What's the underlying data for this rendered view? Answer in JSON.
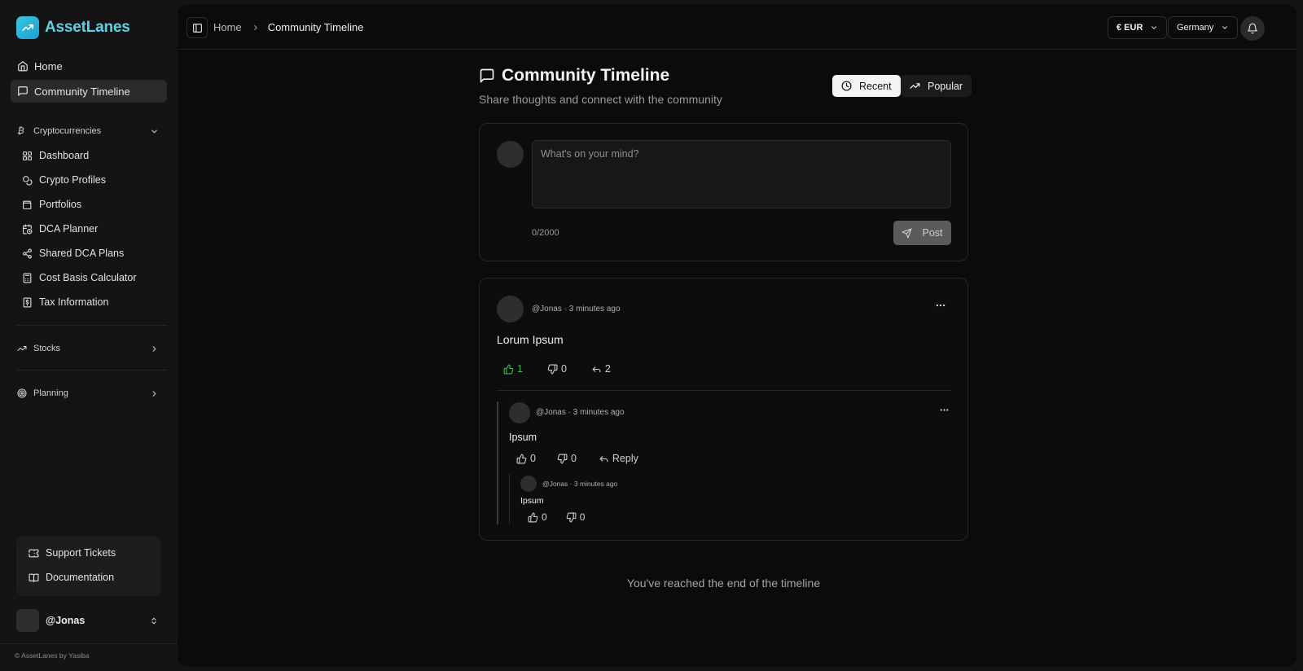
{
  "app": {
    "name": "AssetLanes",
    "copyright": "© AssetLanes by Yasiba"
  },
  "sidebar": {
    "top_items": [
      {
        "label": "Home",
        "icon": "home-icon"
      },
      {
        "label": "Community Timeline",
        "icon": "message-square-icon",
        "active": true
      }
    ],
    "groups": {
      "crypto": {
        "label": "Cryptocurrencies",
        "icon": "bitcoin-icon",
        "expanded": true,
        "items": [
          {
            "label": "Dashboard",
            "icon": "grid-icon"
          },
          {
            "label": "Crypto Profiles",
            "icon": "coins-icon"
          },
          {
            "label": "Portfolios",
            "icon": "wallet-icon"
          },
          {
            "label": "DCA Planner",
            "icon": "calendar-clock-icon"
          },
          {
            "label": "Shared DCA Plans",
            "icon": "share-icon"
          },
          {
            "label": "Cost Basis Calculator",
            "icon": "calculator-icon"
          },
          {
            "label": "Tax Information",
            "icon": "receipt-icon"
          }
        ]
      },
      "stocks": {
        "label": "Stocks",
        "icon": "trending-up-icon",
        "expanded": false
      },
      "planning": {
        "label": "Planning",
        "icon": "target-icon",
        "expanded": false
      }
    },
    "support": [
      {
        "label": "Support Tickets",
        "icon": "ticket-icon"
      },
      {
        "label": "Documentation",
        "icon": "book-icon"
      }
    ],
    "user": {
      "name": "@Jonas"
    }
  },
  "header": {
    "breadcrumb": {
      "home": "Home",
      "current": "Community Timeline"
    },
    "currency": "€ EUR",
    "country": "Germany"
  },
  "page": {
    "title": "Community Timeline",
    "subtitle": "Share thoughts and connect with the community",
    "sort": {
      "recent": "Recent",
      "popular": "Popular",
      "active": "recent"
    }
  },
  "composer": {
    "placeholder": "What's on your mind?",
    "value": "",
    "char_count": "0/2000",
    "post_label": "Post"
  },
  "post": {
    "author": "@Jonas",
    "time": "3 minutes ago",
    "body": "Lorum Ipsum",
    "likes": "1",
    "dislikes": "0",
    "replies": "2",
    "comment": {
      "author": "@Jonas",
      "time": "3 minutes ago",
      "body": "Ipsum",
      "likes": "0",
      "dislikes": "0",
      "reply_label": "Reply",
      "reply": {
        "author": "@Jonas",
        "time": "3 minutes ago",
        "body": "Ipsum",
        "likes": "0",
        "dislikes": "0"
      }
    }
  },
  "end_message": "You've reached the end of the timeline",
  "colors": {
    "accent": "#38c6e0",
    "like_active": "#3fb950",
    "background": "#0b0b0b"
  }
}
